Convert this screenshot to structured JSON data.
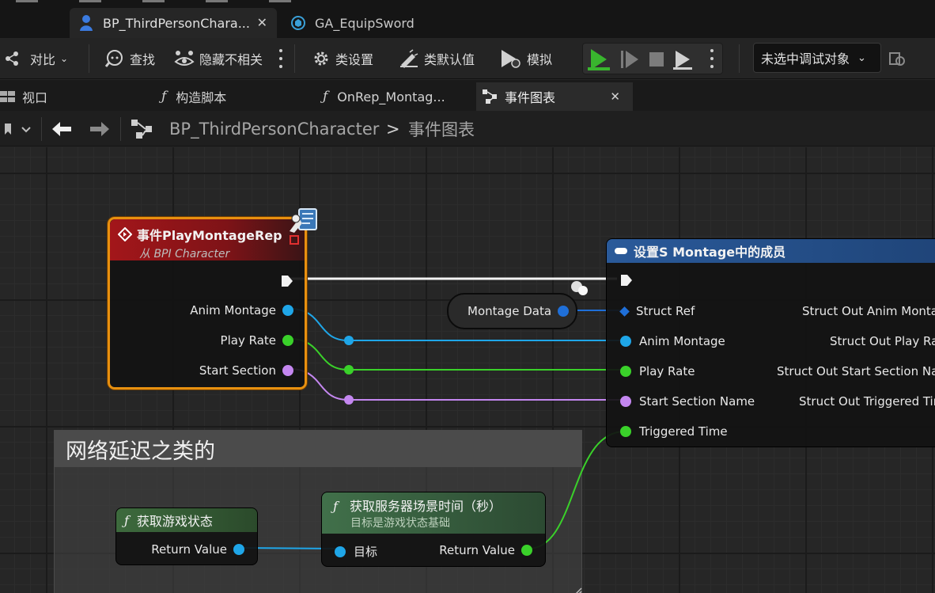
{
  "tabs": [
    {
      "label": "BP_ThirdPersonChara...",
      "active": true
    },
    {
      "label": "GA_EquipSword",
      "active": false
    }
  ],
  "toolbar": {
    "diff": "对比",
    "find": "查找",
    "hide_unrelated": "隐藏不相关",
    "class_settings": "类设置",
    "class_defaults": "类默认值",
    "simulate": "模拟",
    "debug_target": "未选中调试对象"
  },
  "doc_tabs": {
    "viewport": "视口",
    "construction": "构造脚本",
    "onrep": "OnRep_Montag...",
    "event_graph": "事件图表"
  },
  "breadcrumb": {
    "blueprint": "BP_ThirdPersonCharacter",
    "separator": ">",
    "graph": "事件图表"
  },
  "comment": {
    "title": "网络延迟之类的"
  },
  "event_node": {
    "title": "事件PlayMontageRep",
    "subtitle": "从 BPI Character",
    "pins": [
      "Anim Montage",
      "Play Rate",
      "Start Section"
    ]
  },
  "montage_data": {
    "label": "Montage Data"
  },
  "set_node": {
    "title": "设置S Montage中的成员",
    "inputs": [
      "Struct Ref",
      "Anim Montage",
      "Play Rate",
      "Start Section Name",
      "Triggered Time"
    ],
    "outputs": [
      "Struct Out Anim Montage",
      "Struct Out Play Rate",
      "Struct Out Start Section Name",
      "Struct Out Triggered Time"
    ]
  },
  "get_state_node": {
    "title": "获取游戏状态",
    "output": "Return Value"
  },
  "get_time_node": {
    "title": "获取服务器场景时间（秒）",
    "subtitle": "目标是游戏状态基础",
    "input": "目标",
    "output": "Return Value"
  },
  "colors": {
    "object_pin": "#1fa6e8",
    "float_pin": "#3ad12a",
    "name_pin": "#c487f0",
    "struct_pin": "#1f6fd8",
    "selection": "#e8900f"
  }
}
